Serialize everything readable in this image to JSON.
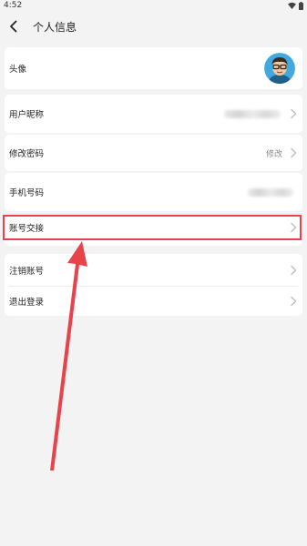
{
  "status_bar": {
    "time": "4:52"
  },
  "header": {
    "title": "个人信息"
  },
  "rows": {
    "avatar": {
      "label": "头像"
    },
    "nickname": {
      "label": "用户昵称"
    },
    "password": {
      "label": "修改密码",
      "value": "修改"
    },
    "phone": {
      "label": "手机号码"
    },
    "handover": {
      "label": "账号交接"
    },
    "cancel": {
      "label": "注销账号"
    },
    "logout": {
      "label": "退出登录"
    }
  },
  "colors": {
    "highlight": "#e8434a",
    "background": "#f3f3f3",
    "card": "#ffffff"
  },
  "icons": [
    "back-arrow-icon",
    "wifi-icon",
    "battery-icon",
    "chevron-right-icon",
    "avatar-image"
  ]
}
